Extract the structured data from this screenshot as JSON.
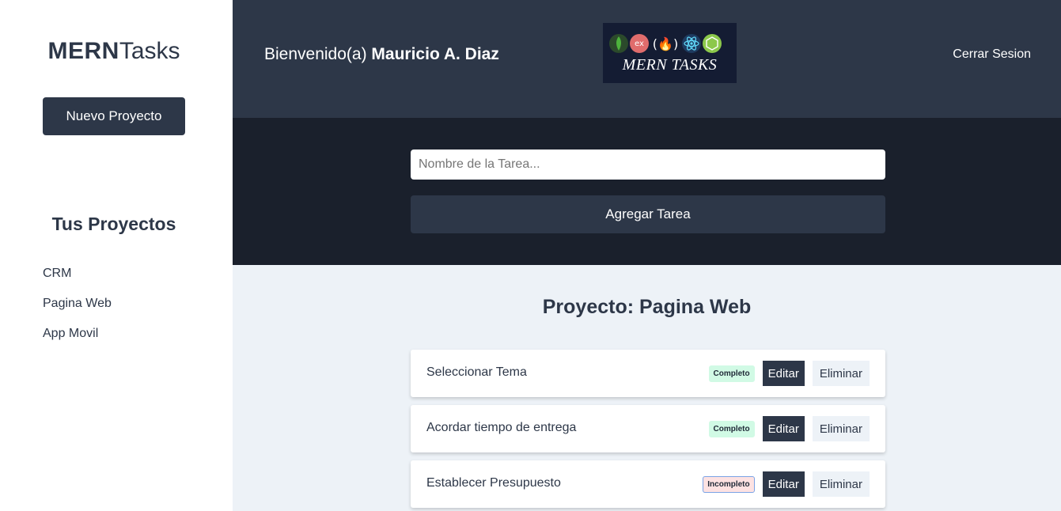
{
  "sidebar": {
    "brand_bold": "MERN",
    "brand_light": "Tasks",
    "new_project_label": "Nuevo Proyecto",
    "projects_title": "Tus Proyectos",
    "projects": [
      {
        "label": "CRM"
      },
      {
        "label": "Pagina Web"
      },
      {
        "label": "App Movil"
      }
    ]
  },
  "header": {
    "welcome_prefix": "Bienvenido(a) ",
    "user_name": "Mauricio A. Diaz",
    "logo_text": "MERN TASKS",
    "logout_label": "Cerrar Sesion"
  },
  "task_form": {
    "placeholder": "Nombre de la Tarea...",
    "submit_label": "Agregar Tarea"
  },
  "main": {
    "project_heading": "Proyecto: Pagina Web",
    "tasks": [
      {
        "name": "Seleccionar Tema",
        "state": "Completo",
        "edit_label": "Editar",
        "delete_label": "Eliminar"
      },
      {
        "name": "Acordar tiempo de entrega",
        "state": "Completo",
        "edit_label": "Editar",
        "delete_label": "Eliminar"
      },
      {
        "name": "Establecer Presupuesto",
        "state": "Incompleto",
        "edit_label": "Editar",
        "delete_label": "Eliminar"
      }
    ]
  },
  "colors": {
    "primary": "#2d3748",
    "dark": "#1a202c",
    "background": "#edf2f7",
    "complete_bg": "#d1fae5",
    "incomplete_bg": "#fde2e2"
  },
  "icons": [
    "mongodb-icon",
    "express-icon",
    "freecodecamp-icon",
    "react-icon",
    "nodejs-icon"
  ]
}
